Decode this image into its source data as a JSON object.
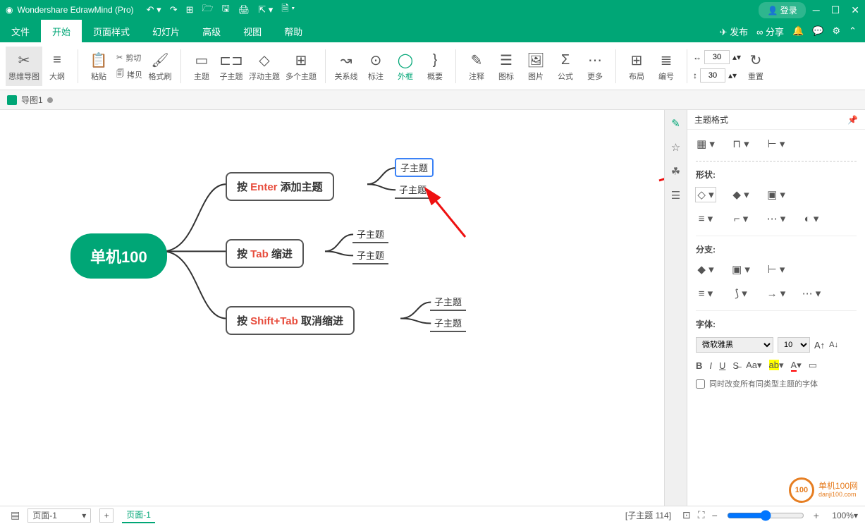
{
  "title_bar": {
    "app_name": "Wondershare EdrawMind (Pro)",
    "login": "登录"
  },
  "menu": {
    "tabs": [
      "文件",
      "开始",
      "页面样式",
      "幻灯片",
      "高级",
      "视图",
      "帮助"
    ],
    "active_index": 1,
    "publish": "发布",
    "share": "分享"
  },
  "ribbon": {
    "mindmap": "思维导图",
    "outline": "大纲",
    "cut": "剪切",
    "paste": "粘贴",
    "copy": "拷贝",
    "format_painter": "格式刷",
    "topic_main": "主题",
    "topic_sub": "子主题",
    "topic_float": "浮动主题",
    "topic_multi": "多个主题",
    "relation": "关系线",
    "callout": "标注",
    "boundary": "外框",
    "summary": "概要",
    "comment": "注释",
    "tag": "图标",
    "image": "图片",
    "formula": "公式",
    "more": "更多",
    "layout": "布局",
    "numbering": "编号",
    "width_val": "30",
    "height_val": "30",
    "reset": "重置"
  },
  "doc_tab": {
    "name": "导图1"
  },
  "mindmap": {
    "root": "单机100",
    "t1_pre": "按 ",
    "t1_kw": "Enter",
    "t1_post": " 添加主题",
    "t2_pre": "按 ",
    "t2_kw": "Tab",
    "t2_post": " 缩进",
    "t3_pre": "按 ",
    "t3_kw": "Shift+Tab",
    "t3_post": " 取消缩进",
    "sub": "子主题"
  },
  "panel": {
    "title": "主题格式",
    "shape_label": "形状:",
    "branch_label": "分支:",
    "font_label": "字体:",
    "font_family": "微软雅黑",
    "font_size": "10",
    "checkbox_label": "同时改变所有同类型主题的字体"
  },
  "status": {
    "page_selector": "页面-1",
    "page_tab": "页面-1",
    "selection_info": "[子主题 114]",
    "zoom": "100%"
  },
  "watermark": {
    "main": "单机100网",
    "sub": "danji100.com"
  }
}
